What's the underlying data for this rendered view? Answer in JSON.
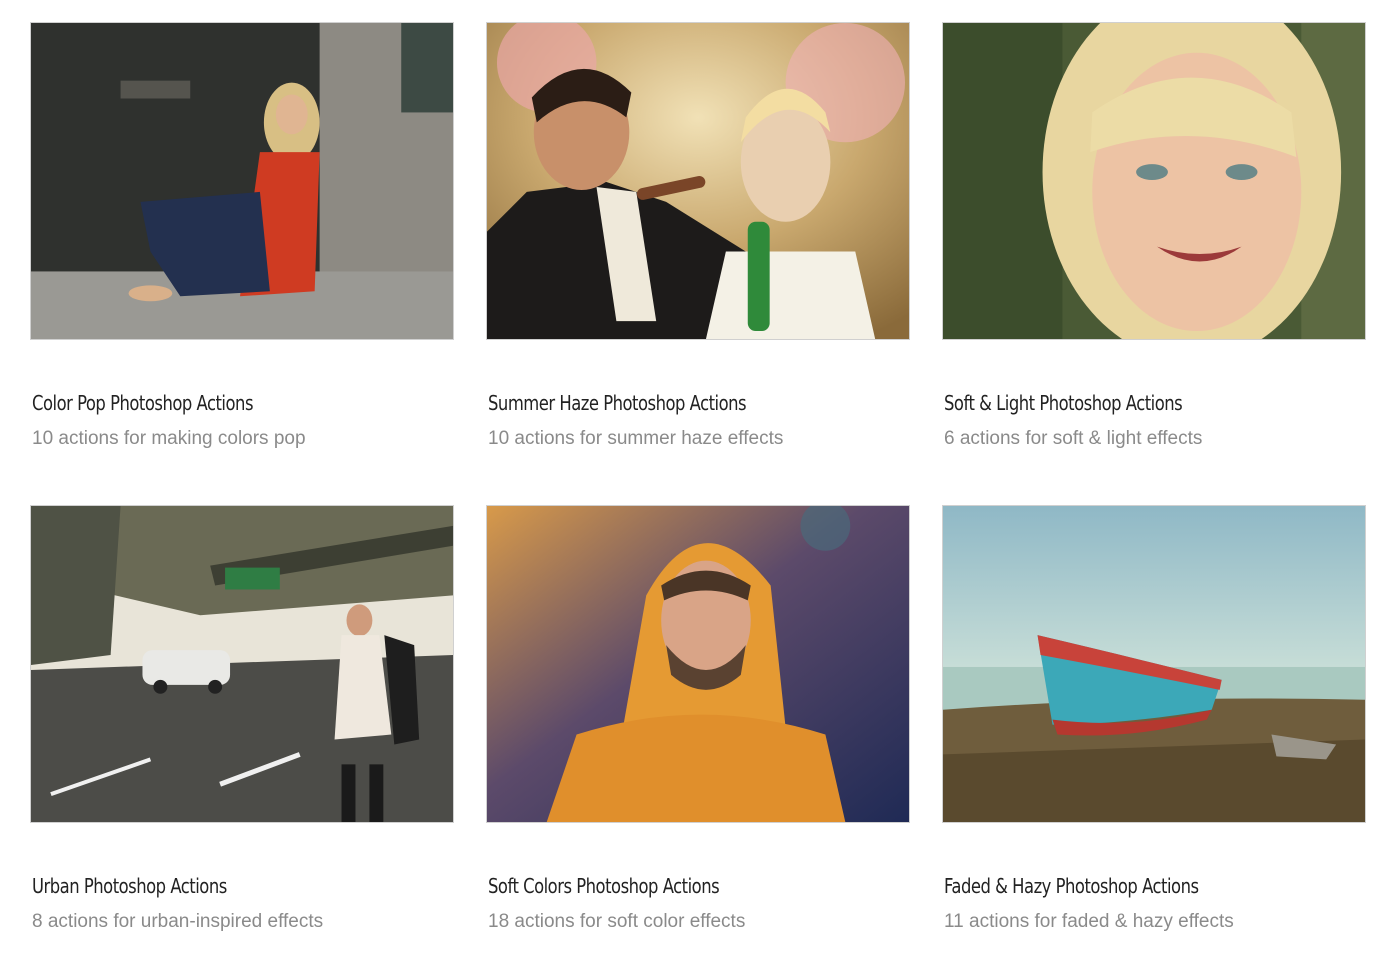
{
  "collections": [
    {
      "title": "Color Pop Photoshop Actions",
      "subtitle": "10 actions for making colors pop",
      "image_icon": "photo-woman-red-top-sitting-by-door"
    },
    {
      "title": "Summer Haze Photoshop Actions",
      "subtitle": "10 actions for summer haze effects",
      "image_icon": "photo-wedding-couple-cigar"
    },
    {
      "title": "Soft & Light Photoshop Actions",
      "subtitle": "6 actions for soft & light effects",
      "image_icon": "photo-smiling-blonde-girl"
    },
    {
      "title": "Urban Photoshop Actions",
      "subtitle": "8 actions for urban-inspired effects",
      "image_icon": "photo-woman-on-street-under-overpass"
    },
    {
      "title": "Soft Colors Photoshop Actions",
      "subtitle": "18 actions for soft color effects",
      "image_icon": "photo-man-orange-hooded-jacket"
    },
    {
      "title": "Faded & Hazy Photoshop Actions",
      "subtitle": "11 actions for faded & hazy effects",
      "image_icon": "photo-red-blue-boat-on-shore"
    }
  ]
}
